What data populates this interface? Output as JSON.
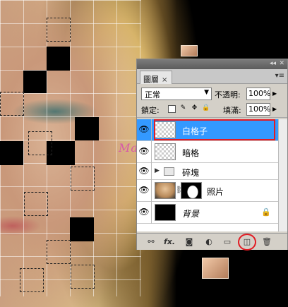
{
  "panel": {
    "tab_label": "圖層",
    "tab_close": "×",
    "blend_mode": "正常",
    "opacity_label": "不透明:",
    "opacity_value": "100%",
    "lock_label": "鎖定:",
    "fill_label": "填滿:",
    "fill_value": "100%"
  },
  "layers": [
    {
      "name": "白格子",
      "selected": true,
      "thumb": "transparent"
    },
    {
      "name": "暗格",
      "selected": false,
      "thumb": "transparent"
    },
    {
      "name": "碎塊",
      "selected": false,
      "thumb": "folder"
    },
    {
      "name": "照片",
      "selected": false,
      "thumb": "photo-with-mask"
    },
    {
      "name": "背景",
      "selected": false,
      "thumb": "black",
      "locked": true
    }
  ],
  "bottom_icons": [
    "link-icon",
    "fx-icon",
    "mask-icon",
    "adjustment-icon",
    "folder-icon",
    "new-layer-icon",
    "trash-icon"
  ],
  "bottom_labels": {
    "fx": "fx."
  },
  "watermark": "Mark"
}
